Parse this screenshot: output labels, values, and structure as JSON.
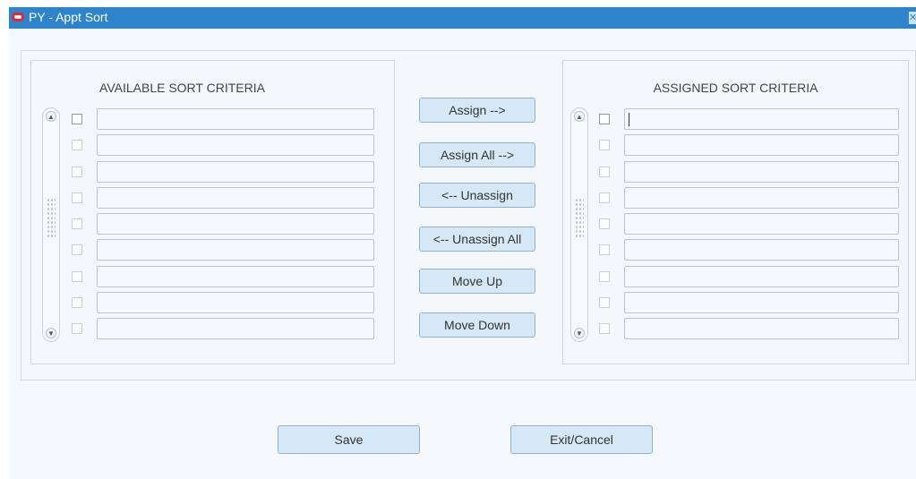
{
  "window": {
    "title": "PY - Appt Sort",
    "logo_icon": "oracle-logo-icon",
    "close_icon": "close-icon",
    "titlebar_color": "#2d84cc",
    "logo_color": "#e8262a"
  },
  "available": {
    "title": "AVAILABLE SORT CRITERIA",
    "rows": [
      "",
      "",
      "",
      "",
      "",
      "",
      "",
      "",
      ""
    ]
  },
  "assigned": {
    "title": "ASSIGNED SORT CRITERIA",
    "rows": [
      "",
      "",
      "",
      "",
      "",
      "",
      "",
      "",
      ""
    ]
  },
  "actions": {
    "assign": "Assign -->",
    "assign_all": "Assign All -->",
    "unassign": "<-- Unassign",
    "unassign_all": "<-- Unassign All",
    "move_up": "Move Up",
    "move_down": "Move Down"
  },
  "footer": {
    "save": "Save",
    "exit_cancel": "Exit/Cancel"
  },
  "colors": {
    "button_bg": "#d6e8f6",
    "button_border": "#8fb3cf"
  }
}
